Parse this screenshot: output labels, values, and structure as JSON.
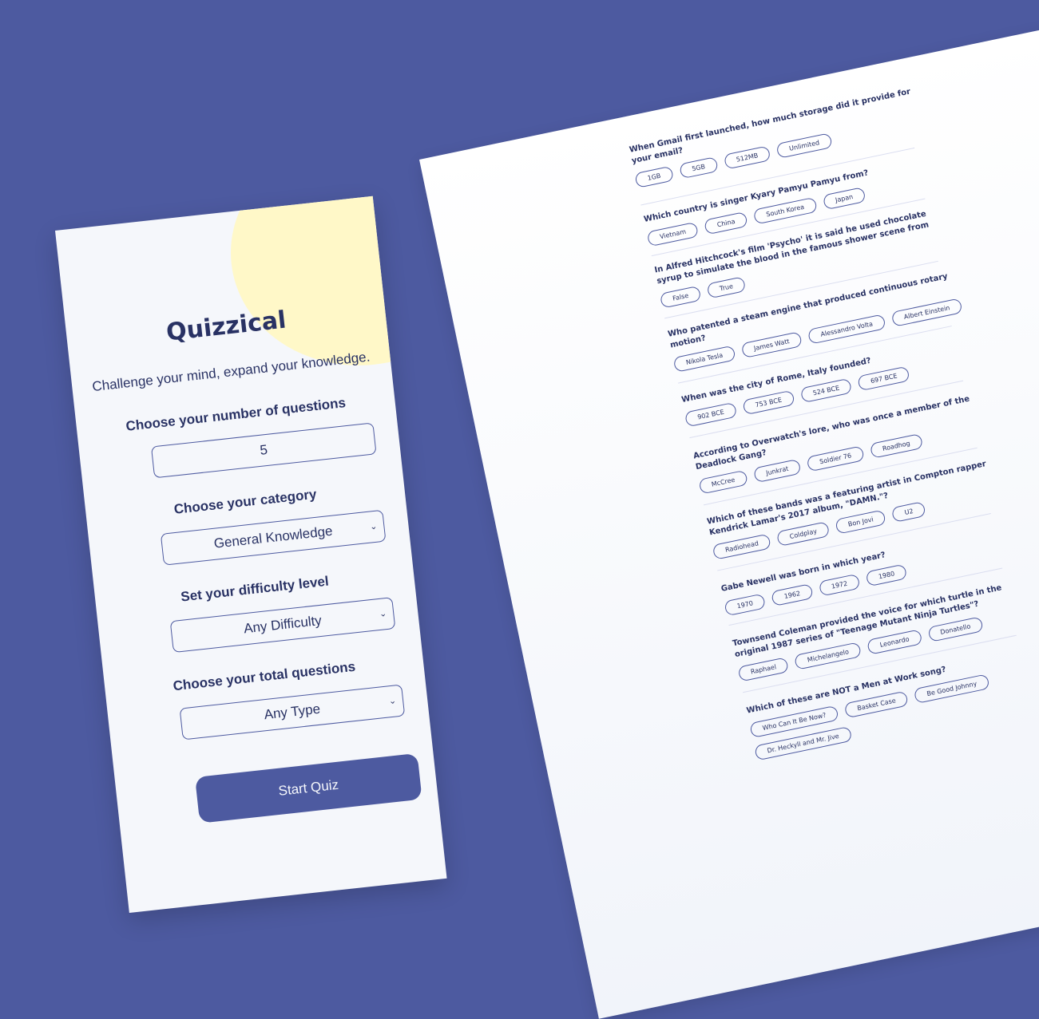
{
  "start": {
    "title": "Quizzical",
    "tagline": "Challenge your mind, expand your knowledge.",
    "num_label": "Choose your number of questions",
    "num_value": "5",
    "category_label": "Choose your category",
    "category_value": "General Knowledge",
    "difficulty_label": "Set your difficulty level",
    "difficulty_value": "Any Difficulty",
    "type_label": "Choose your total questions",
    "type_value": "Any Type",
    "start_button": "Start Quiz",
    "icons": {
      "dropdown": "chevron-down-icon"
    }
  },
  "quiz": {
    "questions": [
      {
        "text": "When Gmail first launched, how much storage did it provide for your email?",
        "answers": [
          "1GB",
          "5GB",
          "512MB",
          "Unlimited"
        ]
      },
      {
        "text": "Which country is singer Kyary Pamyu Pamyu from?",
        "answers": [
          "Vietnam",
          "China",
          "South Korea",
          "Japan"
        ]
      },
      {
        "text": "In Alfred Hitchcock's film 'Psycho' it is said he used chocolate syrup to simulate the blood in the famous shower scene from",
        "answers": [
          "False",
          "True"
        ]
      },
      {
        "text": "Who patented a steam engine that produced continuous rotary motion?",
        "answers": [
          "Nikola Tesla",
          "James Watt",
          "Alessandro Volta",
          "Albert Einstein"
        ]
      },
      {
        "text": "When was the city of Rome, Italy founded?",
        "answers": [
          "902 BCE",
          "753 BCE",
          "524 BCE",
          "697 BCE"
        ]
      },
      {
        "text": "According to Overwatch's lore, who was once a member of the Deadlock Gang?",
        "answers": [
          "McCree",
          "Junkrat",
          "Soldier 76",
          "Roadhog"
        ]
      },
      {
        "text": "Which of these bands was a featuring artist in Compton rapper Kendrick Lamar's 2017 album, \"DAMN.\"?",
        "answers": [
          "Radiohead",
          "Coldplay",
          "Bon Jovi",
          "U2"
        ]
      },
      {
        "text": "Gabe Newell was born in which year?",
        "answers": [
          "1970",
          "1962",
          "1972",
          "1980"
        ]
      },
      {
        "text": "Townsend Coleman provided the voice for which turtle in the original 1987 series of \"Teenage Mutant Ninja Turtles\"?",
        "answers": [
          "Raphael",
          "Michelangelo",
          "Leonardo",
          "Donatello"
        ]
      },
      {
        "text": "Which of these are NOT a Men at Work song?",
        "answers": [
          "Who Can It Be Now?",
          "Basket Case",
          "Be Good Johnny",
          "Dr. Heckyll and Mr. Jive"
        ]
      }
    ]
  },
  "colors": {
    "background": "#4d5aa0",
    "card": "#f5f7fb",
    "text": "#293264",
    "accent_blob": "#fff8c8"
  }
}
